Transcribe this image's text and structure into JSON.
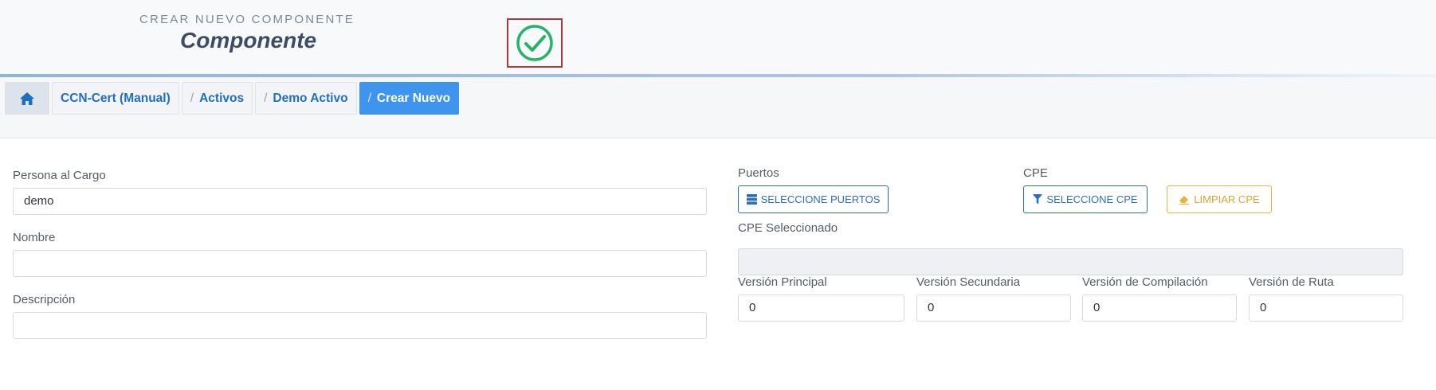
{
  "header": {
    "subtitle": "CREAR NUEVO COMPONENTE",
    "title": "Componente",
    "status_icon": "check-circle-icon",
    "status_color": "#27b36a"
  },
  "breadcrumb": {
    "home_icon": "home-icon",
    "items": [
      {
        "label": "CCN-Cert (Manual)"
      },
      {
        "label": "Activos"
      },
      {
        "label": "Demo Activo"
      },
      {
        "label": "Crear Nuevo"
      }
    ],
    "separator": "/",
    "active_color": "#3f95ee"
  },
  "form": {
    "persona": {
      "label": "Persona al Cargo",
      "value": "demo"
    },
    "nombre": {
      "label": "Nombre",
      "value": ""
    },
    "descripcion": {
      "label": "Descripción",
      "value": ""
    },
    "puertos": {
      "label": "Puertos",
      "button": "SELECCIONE PUERTOS",
      "icon": "server-icon"
    },
    "cpe": {
      "label": "CPE",
      "select_button": "SELECCIONE CPE",
      "select_icon": "filter-icon",
      "clear_button": "LIMPIAR CPE",
      "clear_icon": "eraser-icon"
    },
    "cpe_seleccionado": {
      "label": "CPE Seleccionado",
      "value": ""
    },
    "versions": [
      {
        "label": "Versión Principal",
        "value": "0"
      },
      {
        "label": "Versión Secundaria",
        "value": "0"
      },
      {
        "label": "Versión de Compilación",
        "value": "0"
      },
      {
        "label": "Versión de Ruta",
        "value": "0"
      }
    ]
  }
}
